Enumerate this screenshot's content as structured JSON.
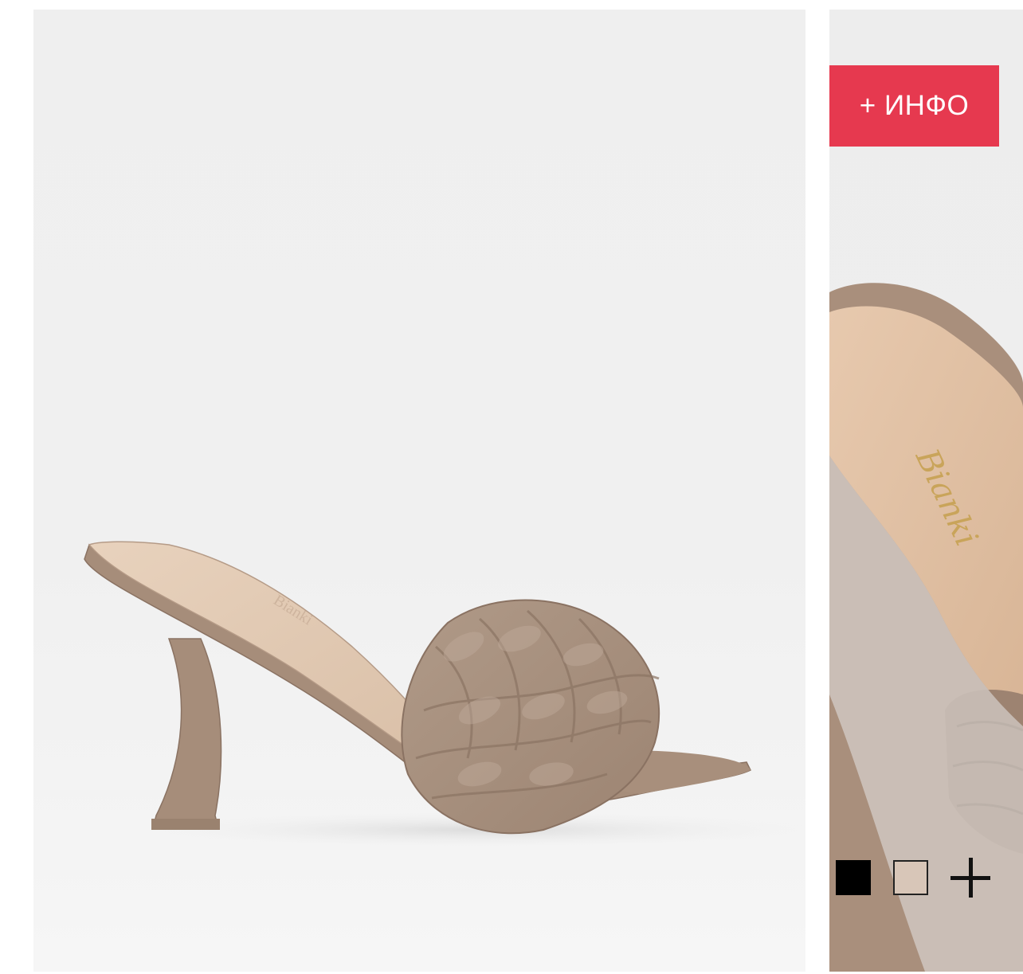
{
  "products": [
    {
      "image_alt": "",
      "colors": {
        "background": "#efefef",
        "shoe": "#a88f7c"
      }
    },
    {
      "info_button_label": "+ ИНФО",
      "brand_logo_text": "Bianki",
      "swatches": [
        {
          "name": "black",
          "color": "#000000",
          "selected": false
        },
        {
          "name": "beige",
          "color": "#d8c6b8",
          "selected": true
        }
      ],
      "more_colors_icon": "plus-icon",
      "colors": {
        "accent": "#e6394f",
        "background": "#eeeeee",
        "shoe": "#a68d7a"
      }
    }
  ]
}
